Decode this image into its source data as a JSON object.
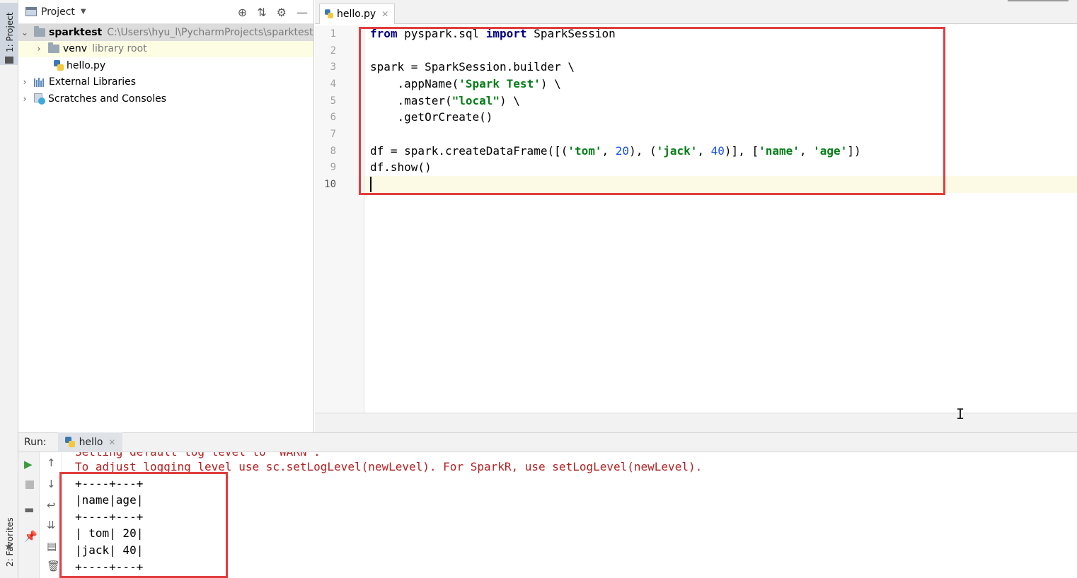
{
  "sidebar": {
    "project_tab": "1: Project",
    "favorites_tab": "2: Favorites"
  },
  "project": {
    "title": "Project",
    "tree": {
      "root_name": "sparktest",
      "root_path": "C:\\Users\\hyu_l\\PycharmProjects\\sparktest",
      "venv_name": "venv",
      "venv_note": "library root",
      "file": "hello.py",
      "external": "External Libraries",
      "scratches": "Scratches and Consoles"
    }
  },
  "editor": {
    "tab_label": "hello.py",
    "line_numbers": [
      "1",
      "2",
      "3",
      "4",
      "5",
      "6",
      "7",
      "8",
      "9",
      "10"
    ],
    "code": {
      "l1_kw1": "from",
      "l1_mod": " pyspark.sql ",
      "l1_kw2": "import",
      "l1_name": " SparkSession",
      "l3": "spark = SparkSession.builder \\",
      "l4_a": "    .appName(",
      "l4_s": "'Spark Test'",
      "l4_b": ") \\",
      "l5_a": "    .master(",
      "l5_s": "\"local\"",
      "l5_b": ") \\",
      "l6": "    .getOrCreate()",
      "l8_a": "df = spark.createDataFrame([(",
      "l8_s1": "'tom'",
      "l8_c1": ", ",
      "l8_n1": "20",
      "l8_c2": "), (",
      "l8_s2": "'jack'",
      "l8_c3": ", ",
      "l8_n2": "40",
      "l8_c4": ")], [",
      "l8_s3": "'name'",
      "l8_c5": ", ",
      "l8_s4": "'age'",
      "l8_c6": "])",
      "l9": "df.show()"
    }
  },
  "run": {
    "label": "Run:",
    "tab": "hello",
    "console": {
      "cut_line": "Setting default log level to \"WARN\".",
      "warn_line": "To adjust logging level use sc.setLogLevel(newLevel). For SparkR, use setLogLevel(newLevel).",
      "sep1": "+----+---+",
      "header": "|name|age|",
      "sep2": "+----+---+",
      "row1": "| tom| 20|",
      "row2": "|jack| 40|",
      "sep3": "+----+---+"
    }
  },
  "colors": {
    "highlight_box": "#e03e3e",
    "keyword": "#000080",
    "string": "#067d17",
    "number": "#1750eb",
    "console_warn": "#b22222"
  }
}
